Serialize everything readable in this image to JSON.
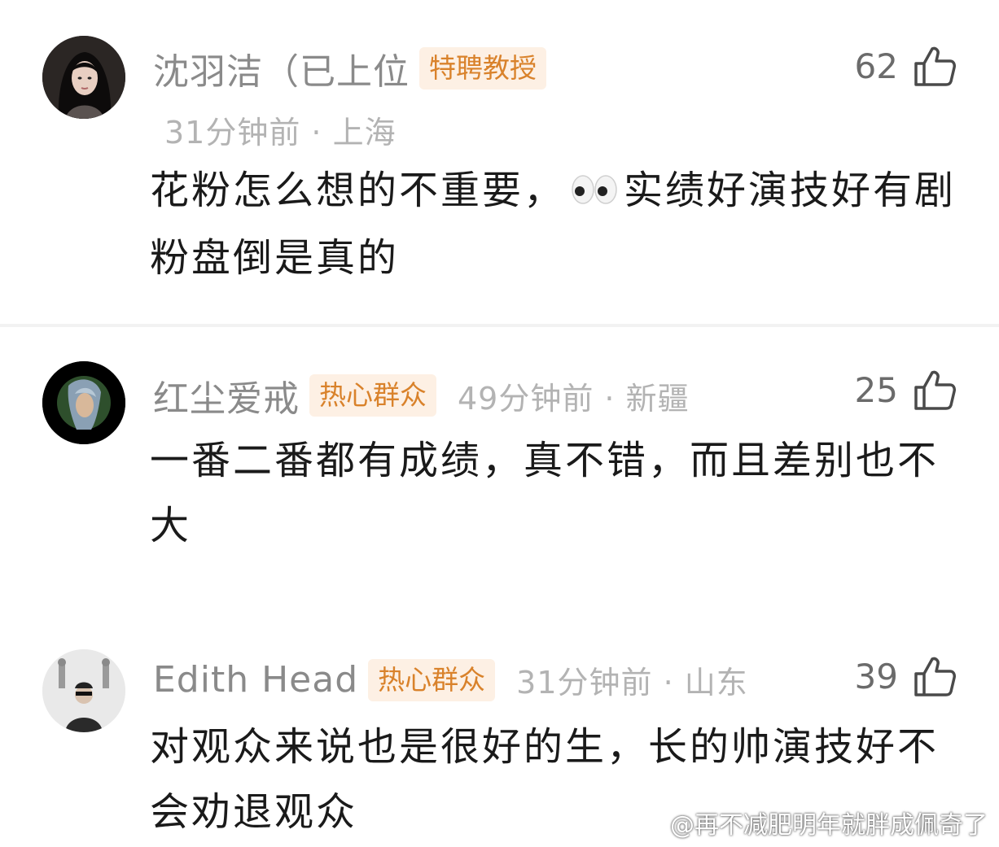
{
  "comments": [
    {
      "username": "沈羽洁（已上位",
      "badge": "特聘教授",
      "meta": "31分钟前 · 上海",
      "likes": "62",
      "text_before_emoji": "花粉怎么想的不重要，",
      "emoji": "eyes-emoji",
      "text_after_emoji": "实绩好演技好有剧粉盘倒是真的"
    },
    {
      "username": "红尘爱戒",
      "badge": "热心群众",
      "meta": "49分钟前 · 新疆",
      "likes": "25",
      "text": "一番二番都有成绩，真不错，而且差别也不大"
    },
    {
      "username": "Edith Head",
      "badge": "热心群众",
      "meta": "31分钟前 · 山东",
      "likes": "39",
      "text": "对观众来说也是很好的生，长的帅演技好不会劝退观众"
    }
  ],
  "watermark": "@再不减肥明年就胖成佩奇了",
  "colors": {
    "badge_bg": "#fdf0e4",
    "badge_text": "#d9822b",
    "username": "#8a8a8a",
    "meta": "#b3b3b3"
  }
}
